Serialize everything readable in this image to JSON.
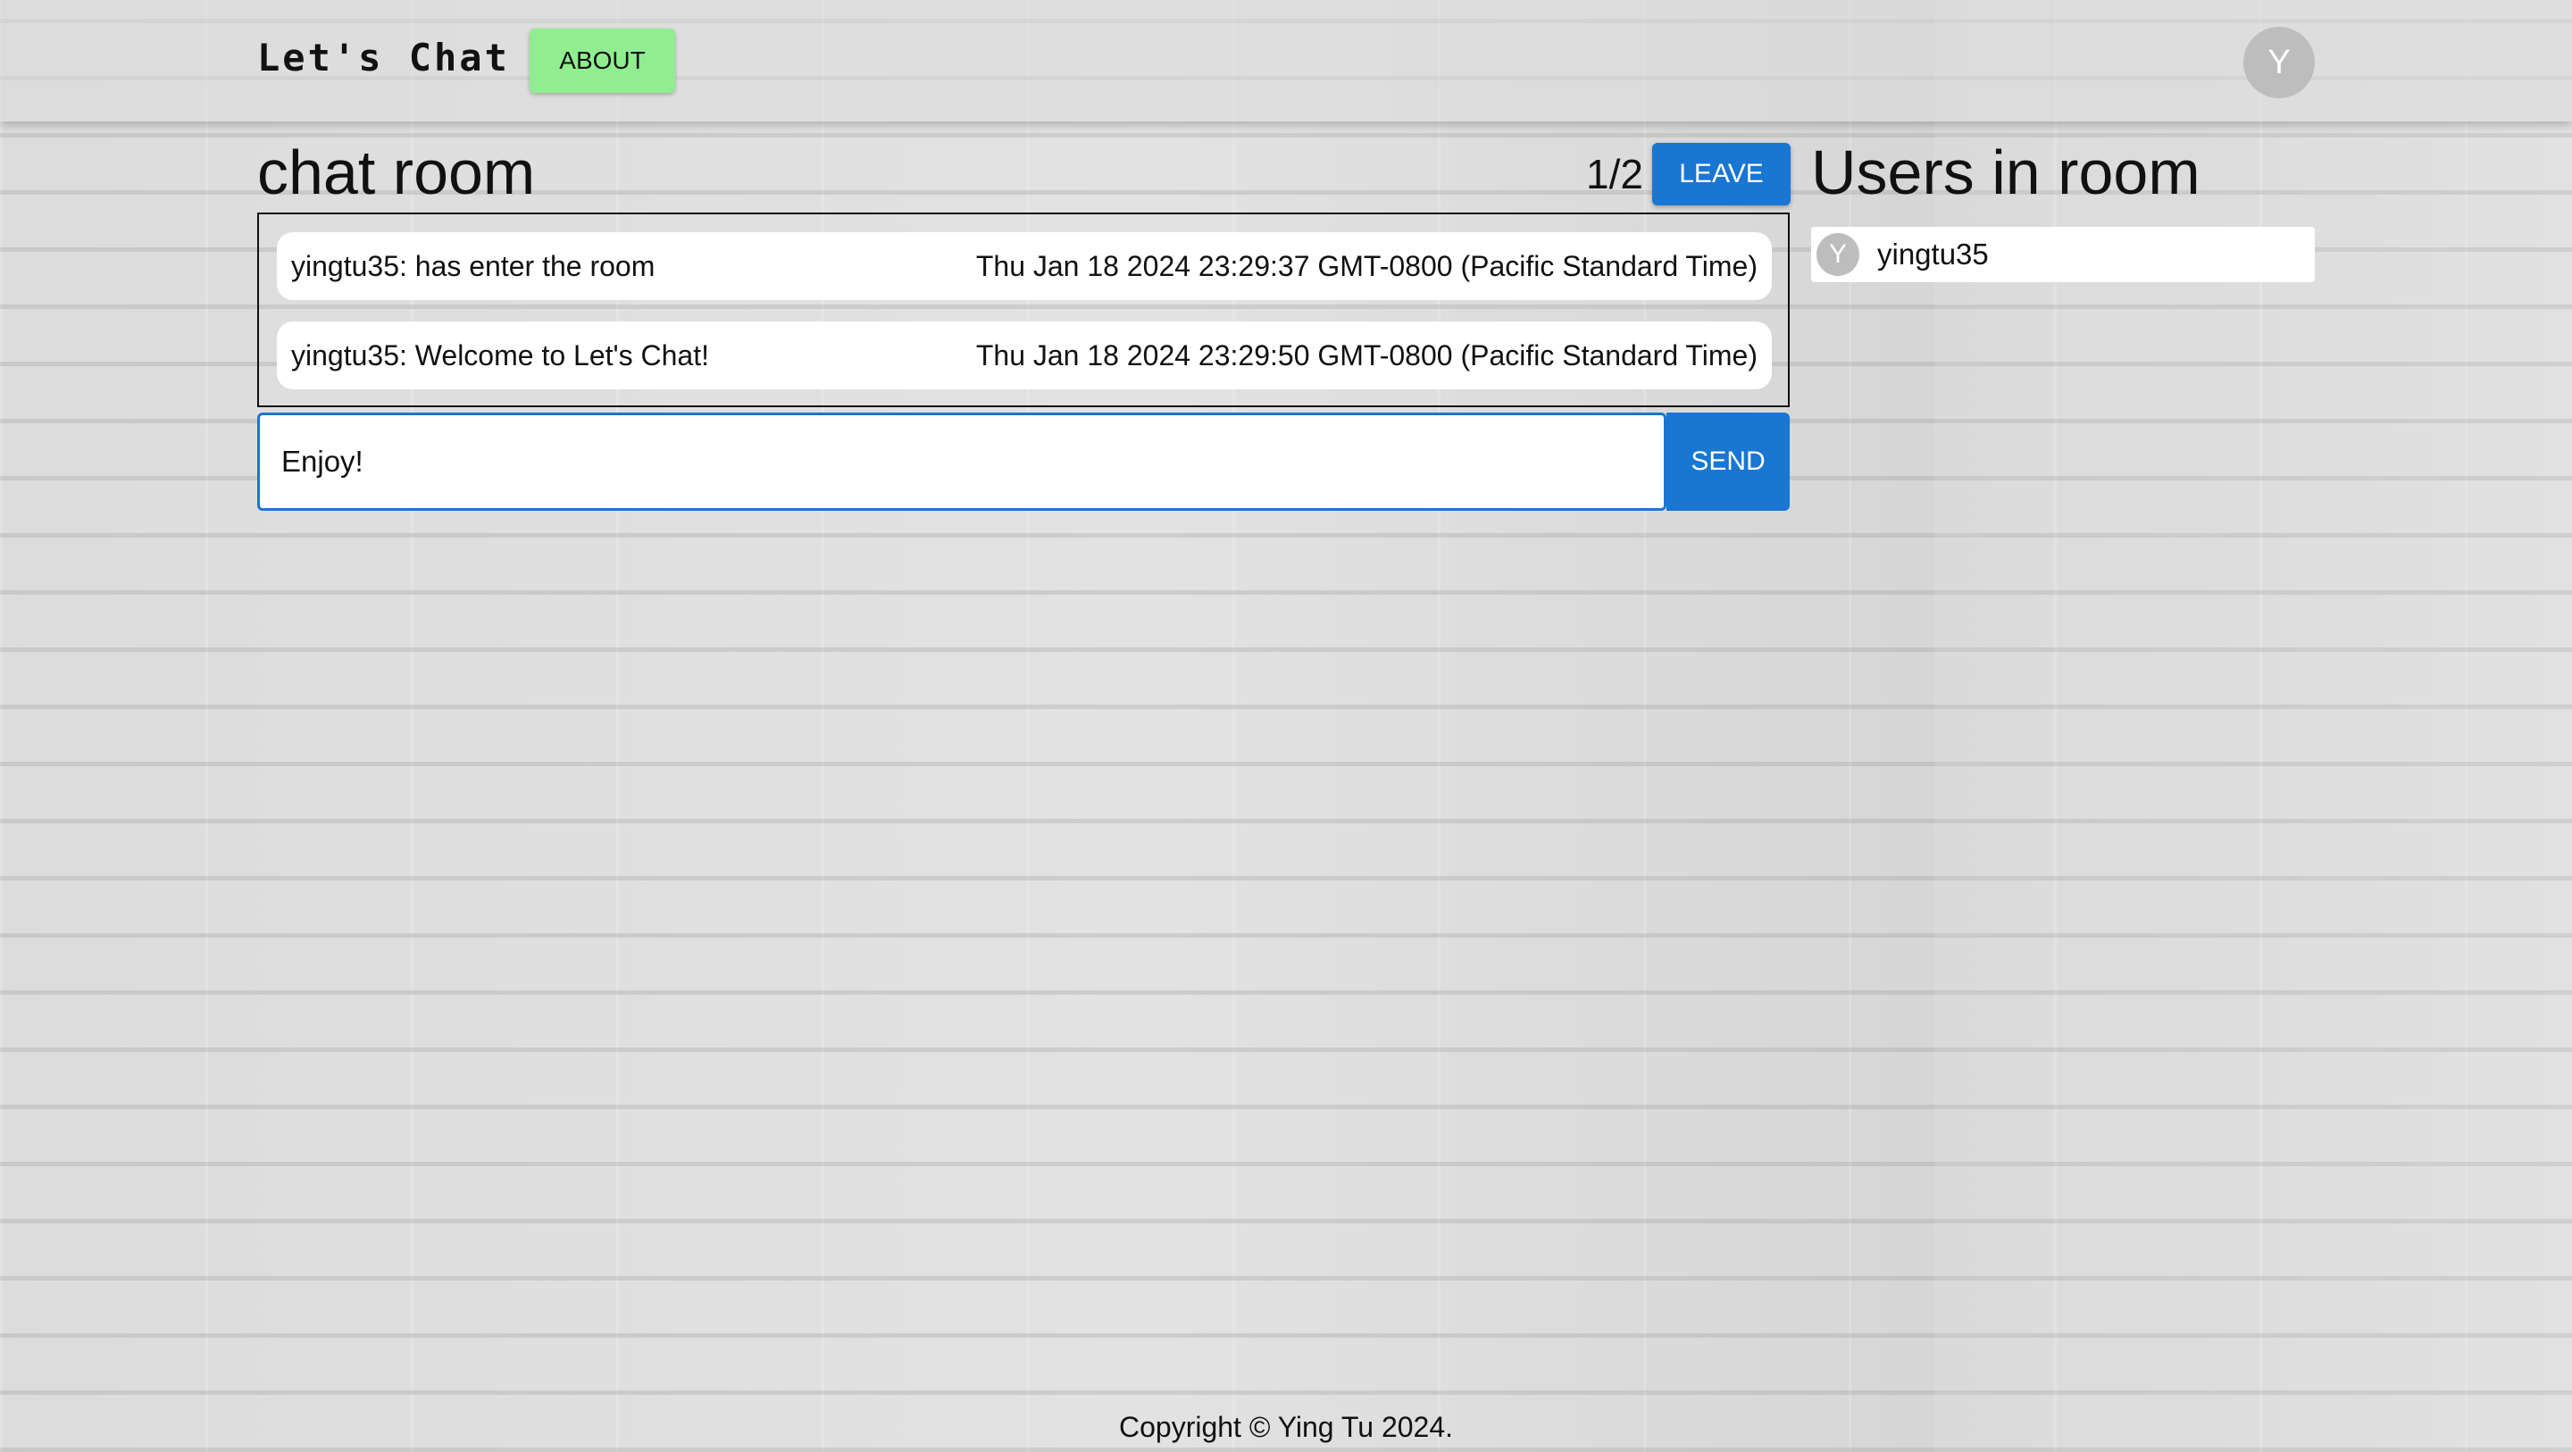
{
  "header": {
    "title": "Let's Chat",
    "about_label": "ABOUT",
    "avatar_initial": "Y"
  },
  "room": {
    "title": "chat room",
    "count": "1/2",
    "leave_label": "LEAVE",
    "messages": [
      {
        "text": "yingtu35: has enter the room",
        "time": "Thu Jan 18 2024 23:29:37 GMT-0800 (Pacific Standard Time)"
      },
      {
        "text": "yingtu35: Welcome to Let's Chat!",
        "time": "Thu Jan 18 2024 23:29:50 GMT-0800 (Pacific Standard Time)"
      }
    ],
    "input_value": "Enjoy!",
    "send_label": "SEND"
  },
  "users": {
    "title": "Users in room",
    "list": [
      {
        "initial": "Y",
        "name": "yingtu35"
      }
    ]
  },
  "footer": {
    "text": "Copyright © Ying Tu 2024."
  },
  "colors": {
    "primary": "#1976d2",
    "about_button": "#90ee90",
    "avatar": "#bdbdbd"
  }
}
